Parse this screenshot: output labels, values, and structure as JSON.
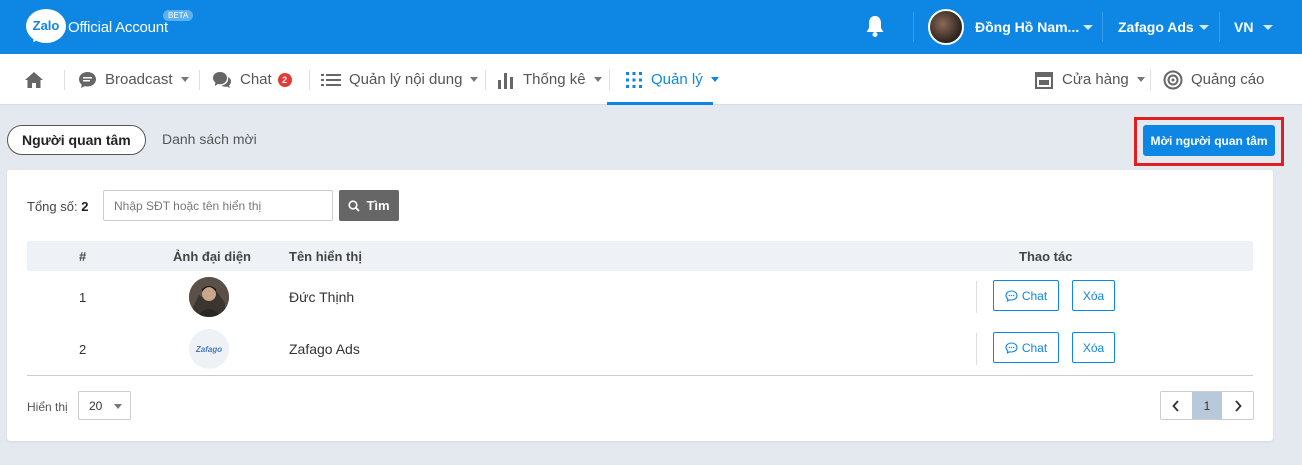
{
  "header": {
    "logo_text": "Zalo",
    "brand": "Official Account",
    "beta": "BETA",
    "user_name": "Đồng Hồ Nam...",
    "account": "Zafago Ads",
    "language": "VN"
  },
  "nav": {
    "broadcast": "Broadcast",
    "chat": "Chat",
    "chat_badge": "2",
    "content": "Quản lý nội dung",
    "stats": "Thống kê",
    "manage": "Quản lý",
    "store": "Cửa hàng",
    "ads": "Quảng cáo"
  },
  "tabs": {
    "followers": "Người quan tâm",
    "invite_list": "Danh sách mời"
  },
  "invite_button": "Mời người quan tâm",
  "search": {
    "total_label": "Tổng số:",
    "total_value": "2",
    "placeholder": "Nhập SĐT hoặc tên hiển thị",
    "button": "Tìm"
  },
  "table": {
    "headers": {
      "num": "#",
      "avatar": "Ảnh đại diện",
      "name": "Tên hiển thị",
      "actions": "Thao tác"
    },
    "rows": [
      {
        "num": "1",
        "name": "Đức Thịnh",
        "avatar_text": "",
        "chat": "Chat",
        "delete": "Xóa"
      },
      {
        "num": "2",
        "name": "Zafago Ads",
        "avatar_text": "Zafago",
        "chat": "Chat",
        "delete": "Xóa"
      }
    ]
  },
  "footer": {
    "show_label": "Hiển thị",
    "page_size": "20",
    "current_page": "1"
  },
  "colors": {
    "primary": "#0d87e3",
    "highlight": "#e02020",
    "badge": "#e53935"
  }
}
